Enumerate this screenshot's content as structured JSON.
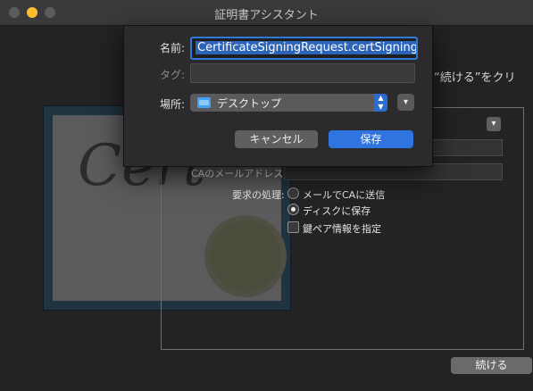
{
  "window": {
    "title": "証明書アシスタント"
  },
  "background": {
    "cert_script": "Cert",
    "intro_text": "“続ける”をクリ",
    "ca_email_label": "CAのメールアドレス:",
    "request_handling_label": "要求の処理:",
    "options": [
      {
        "label": "メールでCAに送信",
        "selected": false
      },
      {
        "label": "ディスクに保存",
        "selected": true
      }
    ],
    "key_pair_checkbox": {
      "label": "鍵ペア情報を指定",
      "checked": false
    },
    "continue_button": "続ける"
  },
  "save_dialog": {
    "name_label": "名前:",
    "name_value": "CertificateSigningRequest.certSigningRequest",
    "tags_label": "タグ:",
    "tags_value": "",
    "location_label": "場所:",
    "location_value": "デスクトップ",
    "cancel_button": "キャンセル",
    "save_button": "保存"
  },
  "colors": {
    "accent": "#2f74e0",
    "folder": "#45a1f5",
    "minimize": "#fdbc2e"
  }
}
